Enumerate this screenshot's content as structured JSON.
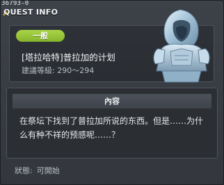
{
  "window": {
    "quest_id": "36793-0",
    "title": "QUEST INFO"
  },
  "quest": {
    "category": "一般",
    "name": "[塔拉哈特]普拉加的计划",
    "level_label": "建議等級",
    "level_range": "290～294",
    "portrait_icon": "hooded-armored-figure-icon"
  },
  "content": {
    "header": "內容",
    "body": "在祭坛下找到了普拉加所说的东西。但是……为什么有种不祥的预感呢……？"
  },
  "status": {
    "label": "狀態:",
    "value": "可開始"
  },
  "colors": {
    "badge_green": "#9acb3f",
    "panel_border": "#4f545b",
    "background": "#3a3e44"
  }
}
